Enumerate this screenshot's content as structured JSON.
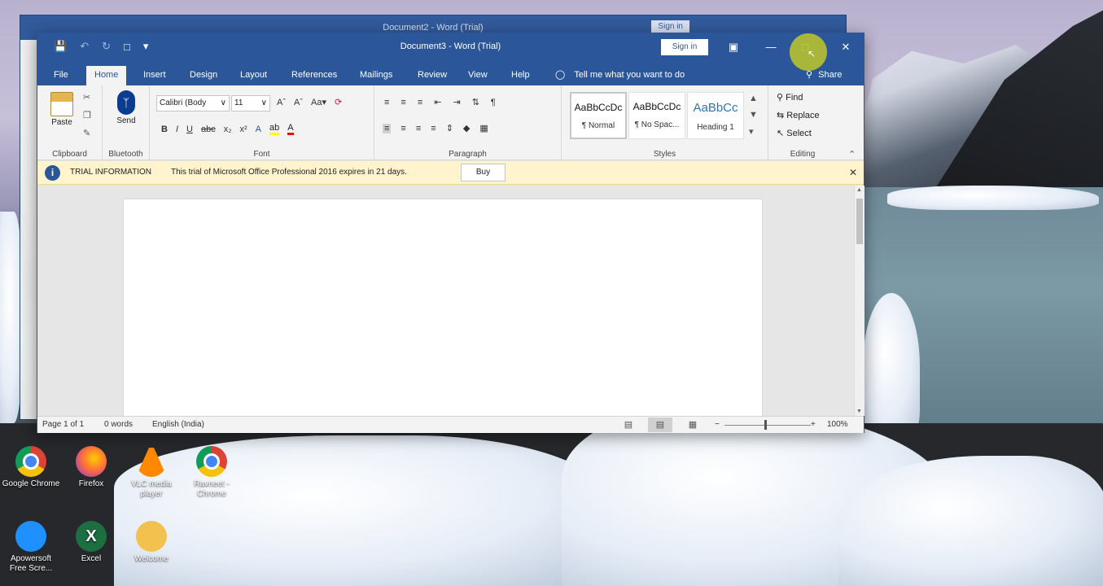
{
  "desktop": {
    "icons": [
      {
        "label": "Google Chrome",
        "icon": "chrome-icon"
      },
      {
        "label": "Firefox",
        "icon": "firefox-icon"
      },
      {
        "label": "VLC media player",
        "icon": "vlc-icon"
      },
      {
        "label": "Ravneet - Chrome",
        "icon": "chrome-icon"
      },
      {
        "label": "Apowersoft Free Scre...",
        "icon": "apowersoft-icon"
      },
      {
        "label": "Excel",
        "icon": "excel-icon"
      },
      {
        "label": "Welcome",
        "icon": "folder-icon"
      }
    ]
  },
  "back_window": {
    "title": "Document2 - Word (Trial)",
    "signin": "Sign in"
  },
  "window": {
    "title": "Document3 - Word (Trial)",
    "signin": "Sign in",
    "tabs": [
      "File",
      "Home",
      "Insert",
      "Design",
      "Layout",
      "References",
      "Mailings",
      "Review",
      "View",
      "Help"
    ],
    "active_tab": "Home",
    "tell_me": "Tell me what you want to do",
    "share": "Share"
  },
  "ribbon": {
    "clipboard": {
      "paste": "Paste",
      "label": "Clipboard"
    },
    "bluetooth": {
      "send": "Send",
      "label": "Bluetooth"
    },
    "font": {
      "family": "Calibri (Body",
      "size": "11",
      "label": "Font"
    },
    "paragraph": {
      "label": "Paragraph"
    },
    "styles": {
      "label": "Styles",
      "items": [
        {
          "sample": "AaBbCcDc",
          "name": "¶ Normal"
        },
        {
          "sample": "AaBbCcDc",
          "name": "¶ No Spac..."
        },
        {
          "sample": "AaBbCc",
          "name": "Heading 1"
        }
      ]
    },
    "editing": {
      "find": "Find",
      "replace": "Replace",
      "select": "Select",
      "label": "Editing"
    }
  },
  "trial_bar": {
    "title": "TRIAL INFORMATION",
    "message": "This trial of Microsoft Office Professional 2016 expires in 21 days.",
    "buy": "Buy"
  },
  "status": {
    "page": "Page 1 of 1",
    "words": "0 words",
    "language": "English (India)",
    "zoom": "100%"
  },
  "colors": {
    "word_blue": "#2b579a",
    "trial_bg": "#fff4ce",
    "cursor_highlight": "#bec828"
  }
}
